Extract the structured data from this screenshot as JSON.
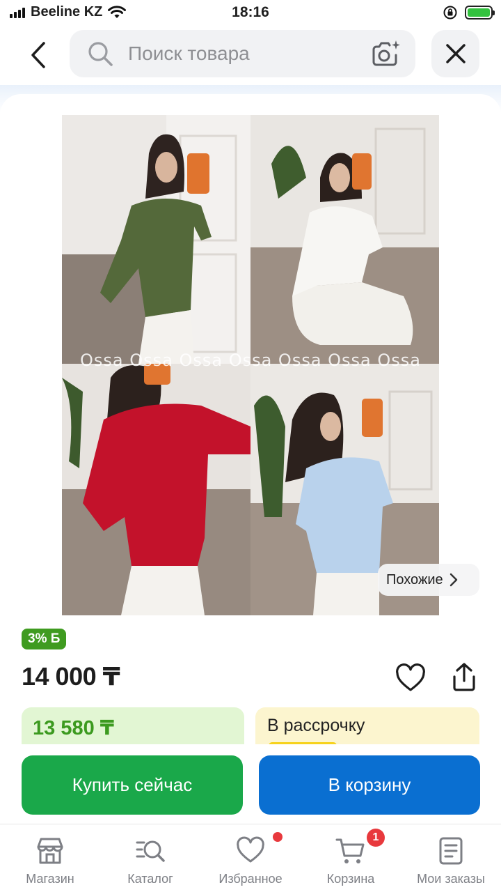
{
  "status_bar": {
    "carrier": "Beeline KZ",
    "time": "18:16",
    "battery_color": "#33c23f"
  },
  "header": {
    "search_placeholder": "Поиск товара",
    "icons": [
      "chevron-left-icon",
      "search-icon",
      "camera-plus-icon",
      "close-icon"
    ]
  },
  "product": {
    "watermark": "Ossa Ossa Ossa Ossa Ossa Ossa Ossa",
    "similar_label": "Похожие",
    "cashback_label": "3% Б",
    "price": "14 000 ₸",
    "card_price": "13 580 ₸",
    "installment_label": "В рассрочку",
    "colors": {
      "cashback_bg": "#3f9b20",
      "card_price_text": "#3c9a1f",
      "card_price_bg": "#e2f6d3",
      "installment_bg": "#fcf5cf"
    }
  },
  "actions": {
    "buy_now": "Купить сейчас",
    "add_to_cart": "В корзину",
    "buy_color": "#1aa84a",
    "cart_color": "#0a6fd1"
  },
  "tabbar": {
    "items": [
      {
        "label": "Магазин",
        "icon": "store-icon"
      },
      {
        "label": "Каталог",
        "icon": "catalog-search-icon"
      },
      {
        "label": "Избранное",
        "icon": "heart-icon"
      },
      {
        "label": "Корзина",
        "icon": "cart-icon"
      },
      {
        "label": "Мои заказы",
        "icon": "orders-icon"
      }
    ],
    "cart_badge": "1"
  }
}
